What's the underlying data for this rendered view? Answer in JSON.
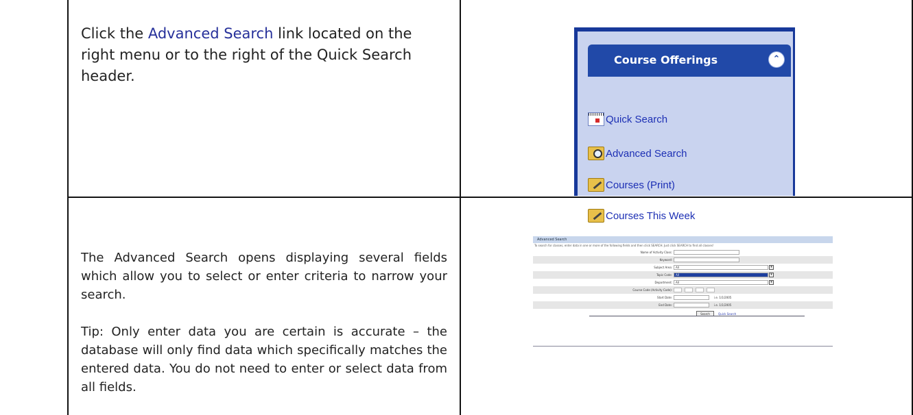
{
  "step1": {
    "text_before": "Click the ",
    "link_text": "Advanced Search",
    "text_after": " link located on the right menu or to the right of the Quick Search header."
  },
  "menu": {
    "title": "Course Offerings",
    "collapse_glyph": "⌃",
    "items": [
      {
        "label": "Quick Search",
        "icon": "calendar-icon"
      },
      {
        "label": "Advanced Search",
        "icon": "folder-search-icon"
      },
      {
        "label": "Courses (Print)",
        "icon": "folder-edit-icon"
      },
      {
        "label": "Courses This Week",
        "icon": "folder-edit-icon"
      }
    ]
  },
  "step2": {
    "text": "The Advanced Search opens displaying several fields which allow you to select or enter criteria to narrow your search.",
    "tip": "Tip:  Only enter data you are certain is accurate – the database will only find data which specifically matches the entered data. You do not need to enter or select data from all fields."
  },
  "advanced_search": {
    "title": "Advanced Search",
    "instructions": "To search for classes, enter data in one or more of the following fields and then click SEARCH. Just click SEARCH to find all classes!",
    "fields": [
      {
        "label": "Name of Activity Class:",
        "value": ""
      },
      {
        "label": "Keyword:",
        "value": ""
      },
      {
        "label": "Subject Area:",
        "value": "All"
      },
      {
        "label": "Topic Code:",
        "value": "All"
      },
      {
        "label": "Department:",
        "value": "All"
      },
      {
        "label": "Course Code (Activity Code):",
        "value": ""
      },
      {
        "label": "Start Date:",
        "value": "",
        "example": "i.e. 1/1/2005"
      },
      {
        "label": "End Date:",
        "value": "",
        "example": "i.e. 1/1/2005"
      }
    ],
    "search_button": "Search",
    "quick_search_link": "Quick Search"
  },
  "colors": {
    "panel_bg": "#c9d3ef",
    "panel_header": "#2149a8",
    "link_blue": "#26309a"
  }
}
